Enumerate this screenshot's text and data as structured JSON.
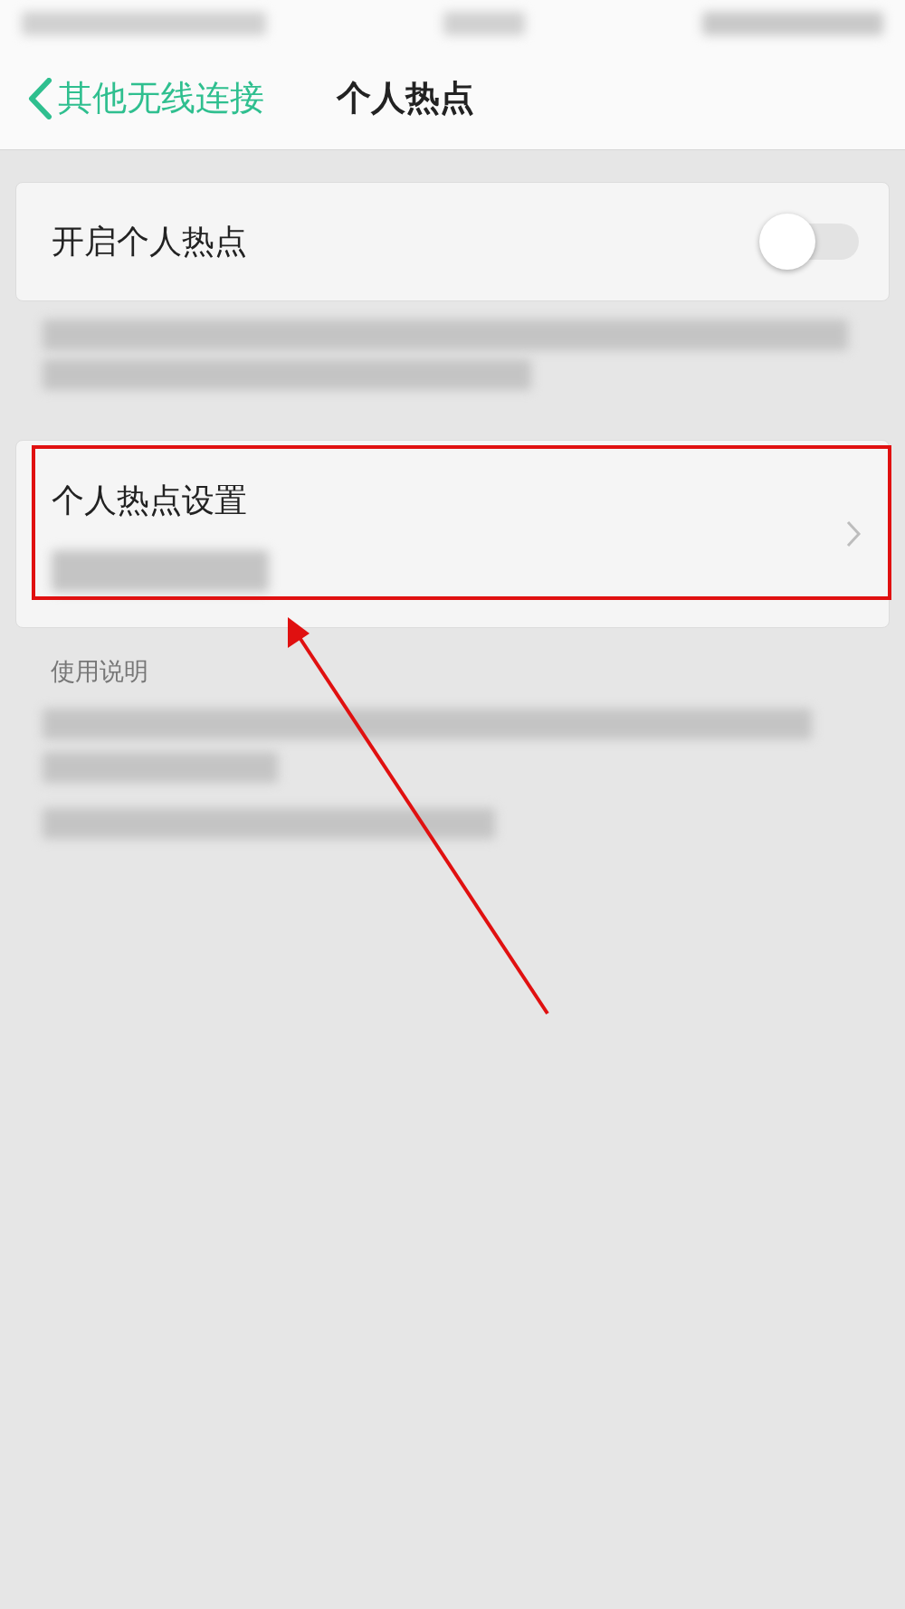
{
  "header": {
    "back_label": "其他无线连接",
    "title": "个人热点"
  },
  "hotspot_switch": {
    "label": "开启个人热点",
    "on": false
  },
  "settings_item": {
    "label": "个人热点设置"
  },
  "instructions": {
    "heading": "使用说明"
  }
}
